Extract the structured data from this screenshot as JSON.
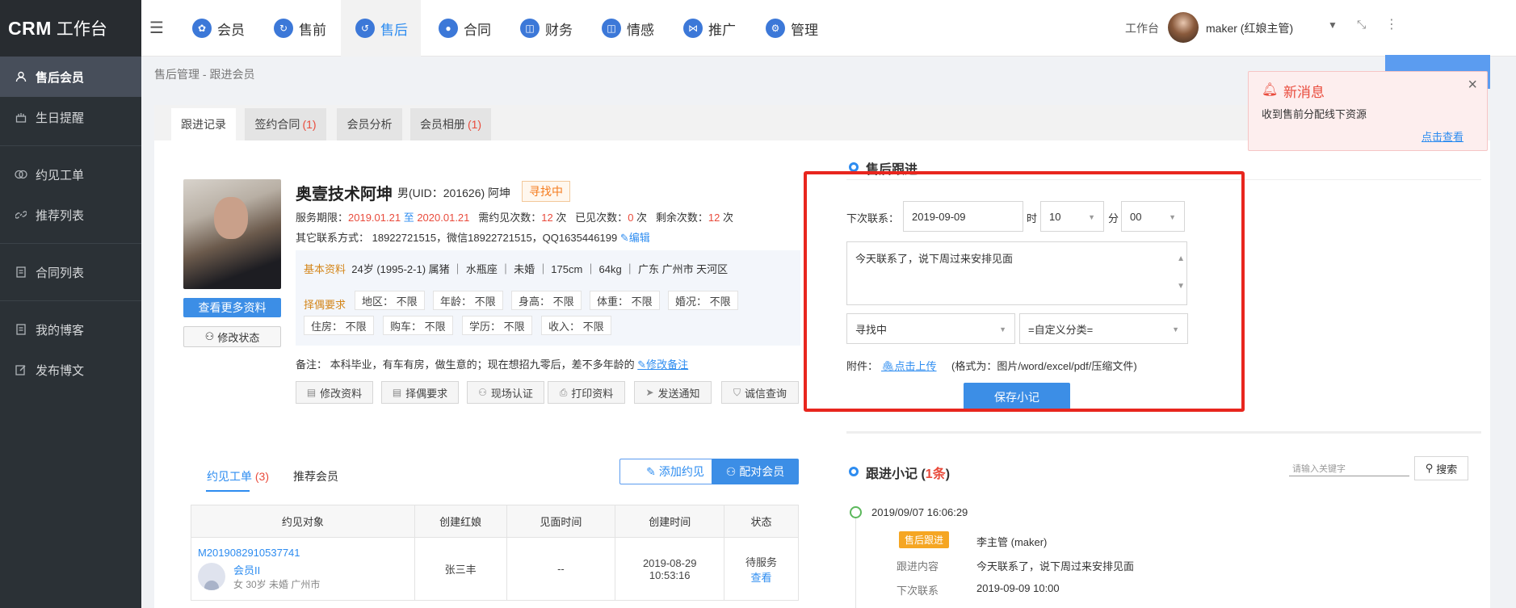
{
  "app": {
    "logo_bold": "CRM",
    "logo_rest": "工作台"
  },
  "sidebar": {
    "items": [
      {
        "label": "售后会员",
        "icon": "user-icon"
      },
      {
        "label": "生日提醒",
        "icon": "cake-icon"
      },
      {
        "label": "约见工单",
        "icon": "meeting-icon"
      },
      {
        "label": "推荐列表",
        "icon": "link-icon"
      },
      {
        "label": "合同列表",
        "icon": "document-icon"
      },
      {
        "label": "我的博客",
        "icon": "blog-icon"
      },
      {
        "label": "发布博文",
        "icon": "edit-icon"
      }
    ]
  },
  "topnav": {
    "tabs": [
      {
        "label": "会员",
        "icon": "members-icon"
      },
      {
        "label": "售前",
        "icon": "presale-icon"
      },
      {
        "label": "售后",
        "icon": "aftersale-icon"
      },
      {
        "label": "合同",
        "icon": "contract-icon"
      },
      {
        "label": "财务",
        "icon": "finance-icon"
      },
      {
        "label": "情感",
        "icon": "emotion-icon"
      },
      {
        "label": "推广",
        "icon": "share-icon"
      },
      {
        "label": "管理",
        "icon": "gear-icon"
      }
    ],
    "workbench": "工作台",
    "user": "maker (红娘主管)"
  },
  "breadcrumb": "售后管理 - 跟进会员",
  "content_tabs": [
    {
      "label": "跟进记录",
      "count": ""
    },
    {
      "label": "签约合同",
      "count": "(1)"
    },
    {
      "label": "会员分析",
      "count": ""
    },
    {
      "label": "会员相册",
      "count": "(1)"
    }
  ],
  "profile": {
    "name": "奥壹技术阿坤",
    "gender_uid": "男(UID：201626) 阿坤",
    "status": "寻找中",
    "service_label": "服务期限：",
    "service_start": "2019.01.21",
    "service_to": " 至 ",
    "service_end": "2020.01.21",
    "req_label": "需约见次数：",
    "req_count": "12",
    "seen_label": " 次   已见次数：",
    "seen_count": "0",
    "left_label": " 次   剩余次数：",
    "left_count": "12",
    "times_unit": " 次",
    "contact": "其它联系方式：  18922721515，微信18922721515，QQ1635446199",
    "edit_link": "编辑",
    "basic_label": "基本资料",
    "basic_info": "24岁 (1995-2-1) 属猪 ｜ 水瓶座 ｜ 未婚 ｜ 175cm ｜ 64kg ｜ 广东 广州市 天河区",
    "req_title": "择偶要求",
    "requirements": [
      "地区：  不限",
      "年龄：  不限",
      "身高：  不限",
      "体重：  不限",
      "婚况：  不限",
      "住房：  不限",
      "购车：  不限",
      "学历：  不限",
      "收入：  不限"
    ],
    "remark": "备注：   本科毕业，有车有房，做生意的；现在想招九零后，差不多年龄的",
    "remark_link": "修改备注",
    "more_btn": "查看更多资料",
    "status_btn": "修改状态",
    "actions": [
      "修改资料",
      "择偶要求",
      "现场认证",
      "打印资料",
      "发送通知",
      "诚信查询"
    ]
  },
  "appointments": {
    "tab1": "约见工单",
    "tab1_count": "(3)",
    "tab2": "推荐会员",
    "add_btn": "添加约见",
    "match_btn": "配对会员",
    "headers": [
      "约见对象",
      "创建红娘",
      "见面时间",
      "创建时间",
      "状态"
    ],
    "rows": [
      {
        "order_id": "M2019082910537741",
        "member_name": "会员II",
        "member_info": "女 30岁 未婚  广州市",
        "matchmaker": "张三丰",
        "meet_time": "--",
        "created_date": "2019-08-29",
        "created_time": "10:53:16",
        "status": "待服务",
        "view": "查看"
      }
    ]
  },
  "followup": {
    "title": "售后跟进",
    "next_label": "下次联系：",
    "date": "2019-09-09",
    "hour_label": "时",
    "hour": "10",
    "minute_label": "分",
    "minute": "00",
    "note": "今天联系了，说下周过来安排见面",
    "status_select": "寻找中",
    "category_select": "=自定义分类=",
    "attach_label": "附件：",
    "upload_link": "点击上传",
    "format_hint": "(格式为：图片/word/excel/pdf/压缩文件)",
    "save_btn": "保存小记"
  },
  "notes": {
    "title": "跟进小记",
    "count": "1条",
    "search_placeholder": "请输入关键字",
    "search_btn": "搜索",
    "entries": [
      {
        "time": "2019/09/07 16:06:29",
        "badge": "售后跟进",
        "author": "李主管 (maker)",
        "content_label": "跟进内容",
        "content": "今天联系了，说下周过来安排见面",
        "next_label": "下次联系",
        "next": "2019-09-09 10:00"
      }
    ]
  },
  "toast": {
    "title": "新消息",
    "body": "收到售前分配线下资源",
    "link": "点击查看"
  },
  "colors": {
    "accent": "#2d8cf0",
    "danger": "#e94b3c",
    "sidebar": "#2b3136",
    "highlight_frame": "#e8261e"
  }
}
